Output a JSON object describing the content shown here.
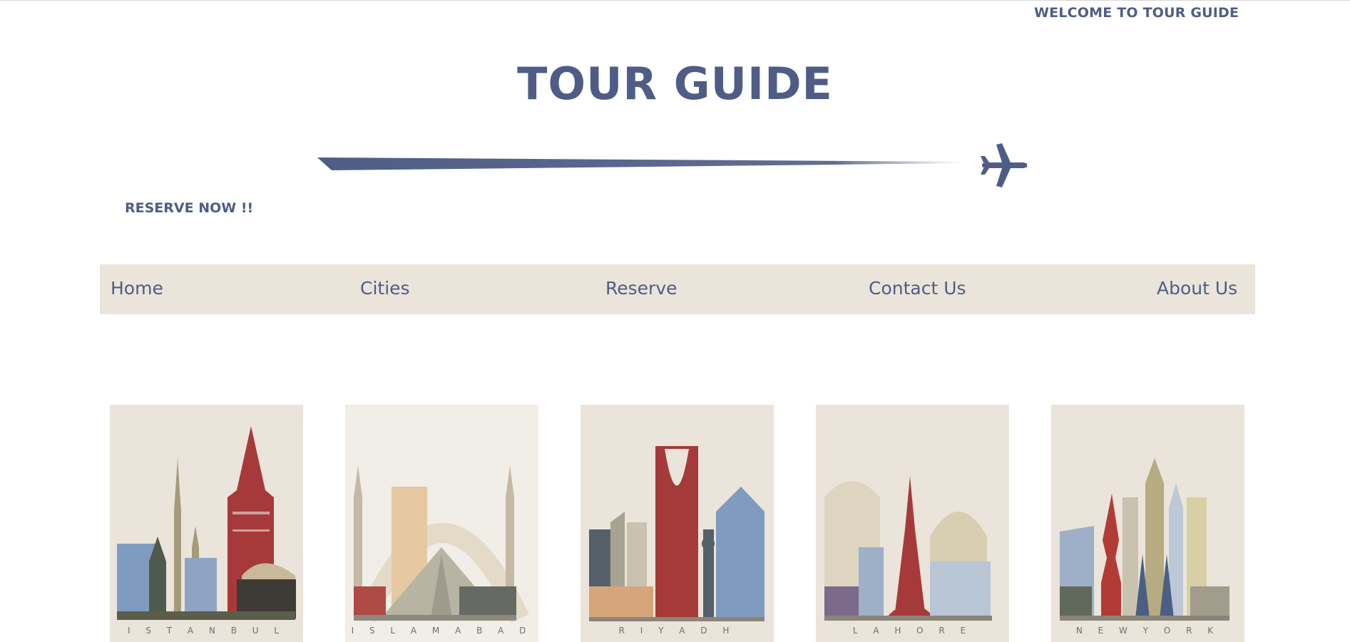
{
  "header": {
    "welcome": "WELCOME TO TOUR GUIDE",
    "title": "TOUR GUIDE",
    "reserve_now": "RESERVE NOW !!"
  },
  "nav": {
    "items": [
      "Home",
      "Cities",
      "Reserve",
      "Contact Us",
      "About Us"
    ]
  },
  "cities": [
    {
      "name": "ISTANBUL",
      "caption": "I S T A N B U L"
    },
    {
      "name": "ISLAMABAD",
      "caption": "I S L A M A B A D"
    },
    {
      "name": "RIYADH",
      "caption": "R I Y A D H"
    },
    {
      "name": "LAHORE",
      "caption": "L A H O R E"
    },
    {
      "name": "NEW YORK",
      "caption": "N E W   Y O R K"
    }
  ],
  "colors": {
    "brand": "#4f5d86",
    "nav_background": "#ebe4da",
    "card_background": "#ebe4da",
    "accent_red": "#a63a3a"
  },
  "icons": {
    "banner": "airplane-icon"
  }
}
